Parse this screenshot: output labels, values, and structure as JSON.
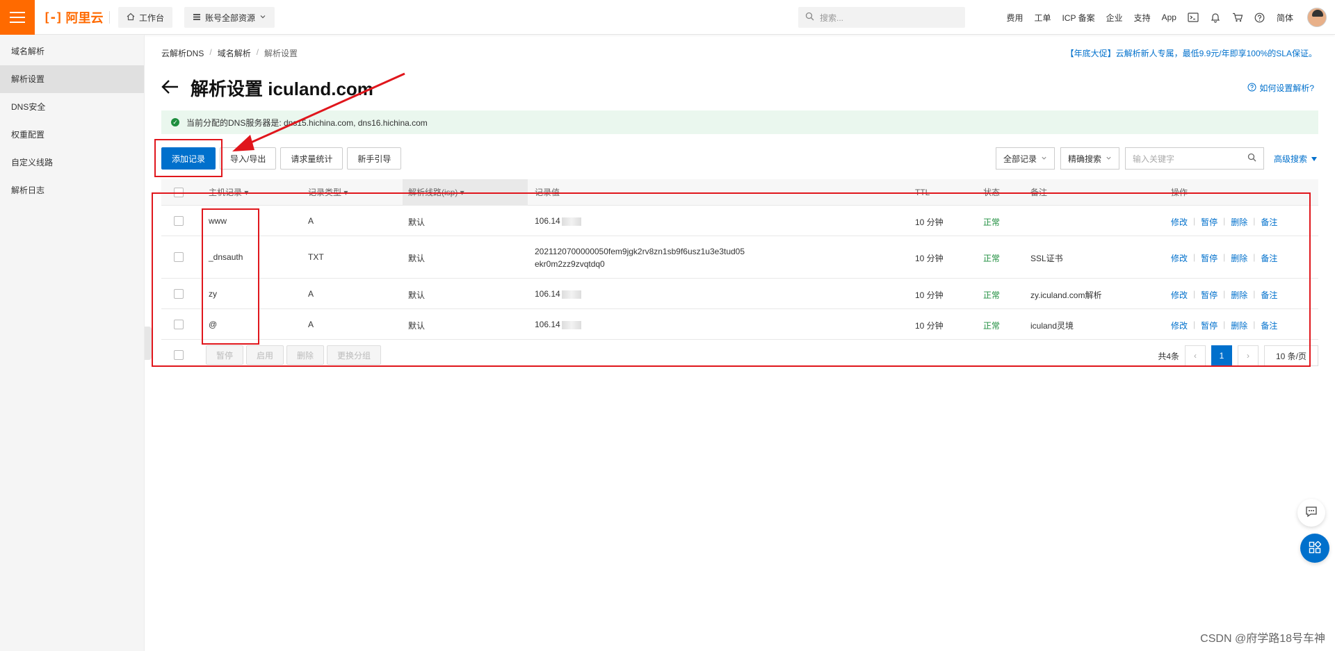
{
  "topbar": {
    "logo_text": "阿里云",
    "logo_mark": "[-]",
    "workbench_label": "工作台",
    "resources_label": "账号全部资源",
    "search_placeholder": "搜索...",
    "links": [
      "费用",
      "工单",
      "ICP 备案",
      "企业",
      "支持",
      "App"
    ],
    "lang_label": "简体"
  },
  "sidebar": {
    "items": [
      {
        "label": "域名解析",
        "active": false
      },
      {
        "label": "解析设置",
        "active": true
      },
      {
        "label": "DNS安全",
        "active": false
      },
      {
        "label": "权重配置",
        "active": false
      },
      {
        "label": "自定义线路",
        "active": false
      },
      {
        "label": "解析日志",
        "active": false
      }
    ]
  },
  "breadcrumb": {
    "items": [
      "云解析DNS",
      "域名解析"
    ],
    "current": "解析设置",
    "separator": "/"
  },
  "promo": "【年底大促】云解析新人专属，最低9.9元/年即享100%的SLA保证。",
  "page": {
    "title": "解析设置 iculand.com",
    "help_link": "如何设置解析?",
    "notice": "当前分配的DNS服务器是: dns15.hichina.com, dns16.hichina.com"
  },
  "toolbar": {
    "add_label": "添加记录",
    "import_label": "导入/导出",
    "stats_label": "请求量统计",
    "guide_label": "新手引导",
    "filter_label": "全部记录",
    "match_label": "精确搜索",
    "keyword_placeholder": "输入关键字",
    "advanced_label": "高级搜索"
  },
  "table": {
    "headers": {
      "host": "主机记录",
      "type": "记录类型",
      "line": "解析线路(isp)",
      "value": "记录值",
      "ttl": "TTL",
      "status": "状态",
      "remark": "备注",
      "ops": "操作"
    },
    "rows": [
      {
        "host": "www",
        "type": "A",
        "line": "默认",
        "value1": "106.14",
        "value2": "",
        "blurred": true,
        "ttl": "10 分钟",
        "status": "正常",
        "remark": ""
      },
      {
        "host": "_dnsauth",
        "type": "TXT",
        "line": "默认",
        "value1": "2021120700000050fem9jgk2rv8zn1sb9f6usz1u3e3tud05",
        "value2": "ekr0m2zz9zvqtdq0",
        "blurred": false,
        "ttl": "10 分钟",
        "status": "正常",
        "remark": "SSL证书"
      },
      {
        "host": "zy",
        "type": "A",
        "line": "默认",
        "value1": "106.14",
        "value2": "",
        "blurred": true,
        "ttl": "10 分钟",
        "status": "正常",
        "remark": "zy.iculand.com解析"
      },
      {
        "host": "@",
        "type": "A",
        "line": "默认",
        "value1": "106.14",
        "value2": "",
        "blurred": true,
        "ttl": "10 分钟",
        "status": "正常",
        "remark": "iculand灵境"
      }
    ],
    "ops": {
      "edit": "修改",
      "pause": "暂停",
      "delete": "删除",
      "remark": "备注"
    }
  },
  "footer": {
    "bulk": [
      "暂停",
      "启用",
      "删除",
      "更换分组"
    ],
    "total": "共4条",
    "page_current": "1",
    "page_size": "10 条/页"
  },
  "watermark": "CSDN @府学路18号车神",
  "colors": {
    "accent": "#0070cc",
    "brand": "#ff6a00",
    "ok": "#1e8e3e",
    "annotation": "#e0161c"
  }
}
